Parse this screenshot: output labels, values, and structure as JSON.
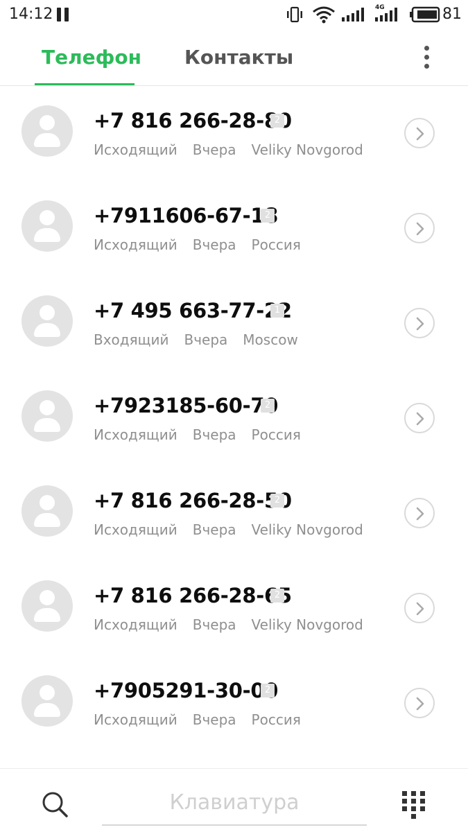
{
  "status_bar": {
    "time": "14:12",
    "battery": "81",
    "network_label": "4G"
  },
  "tabs": [
    {
      "label": "Телефон",
      "active": true
    },
    {
      "label": "Контакты",
      "active": false
    }
  ],
  "calls": [
    {
      "number": "+7 816 266-28-80",
      "sim": "2",
      "type": "Исходящий",
      "date": "Вчера",
      "location": "Veliky Novgorod"
    },
    {
      "number": "+7911606-67-18",
      "sim": "2",
      "type": "Исходящий",
      "date": "Вчера",
      "location": "Россия"
    },
    {
      "number": "+7 495 663-77-22",
      "sim": "1",
      "type": "Входящий",
      "date": "Вчера",
      "location": "Moscow"
    },
    {
      "number": "+7923185-60-70",
      "sim": "2",
      "type": "Исходящий",
      "date": "Вчера",
      "location": "Россия"
    },
    {
      "number": "+7 816 266-28-50",
      "sim": "2",
      "type": "Исходящий",
      "date": "Вчера",
      "location": "Veliky Novgorod"
    },
    {
      "number": "+7 816 266-28-65",
      "sim": "2",
      "type": "Исходящий",
      "date": "Вчера",
      "location": "Veliky Novgorod"
    },
    {
      "number": "+7905291-30-00",
      "sim": "2",
      "type": "Исходящий",
      "date": "Вчера",
      "location": "Россия"
    }
  ],
  "bottom_bar": {
    "keypad_label": "Клавиатура"
  },
  "colors": {
    "accent": "#2dbb5a",
    "secondary_text": "#8f8f8f"
  }
}
